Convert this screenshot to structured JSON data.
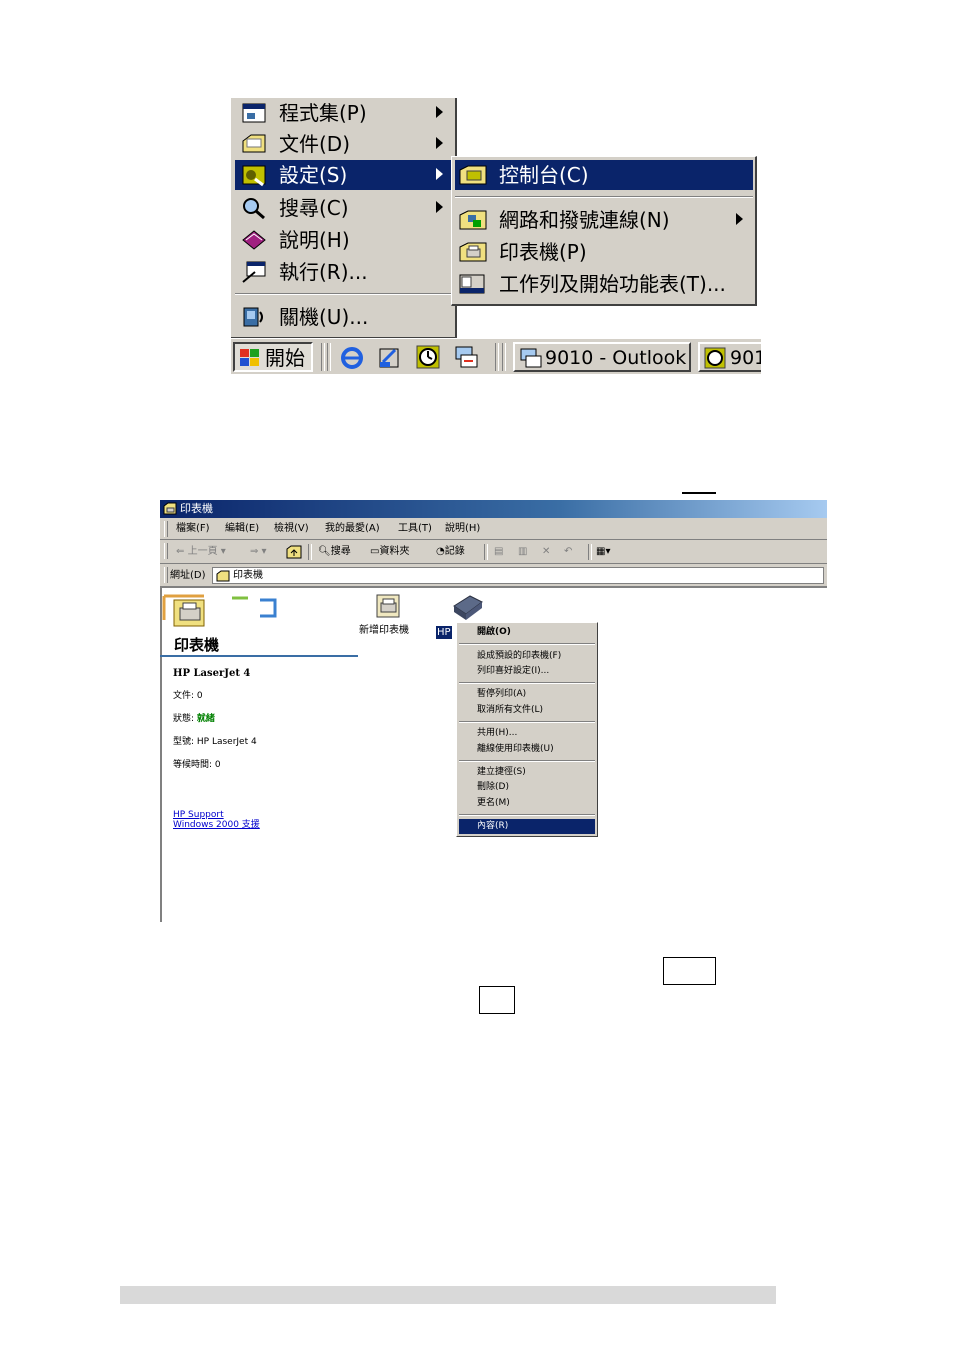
{
  "start_menu": {
    "items": [
      {
        "label": "程式集(P)",
        "icon": "programs-icon",
        "has_submenu": true
      },
      {
        "label": "文件(D)",
        "icon": "documents-icon",
        "has_submenu": true
      },
      {
        "label": "設定(S)",
        "icon": "settings-icon",
        "has_submenu": true,
        "selected": true
      },
      {
        "label": "搜尋(C)",
        "icon": "search-icon",
        "has_submenu": true
      },
      {
        "label": "說明(H)",
        "icon": "help-book-icon",
        "has_submenu": false
      },
      {
        "label": "執行(R)...",
        "icon": "run-icon",
        "has_submenu": false
      },
      {
        "label": "關機(U)...",
        "icon": "shutdown-icon",
        "has_submenu": false
      }
    ],
    "settings_submenu": [
      {
        "label": "控制台(C)",
        "icon": "control-panel-icon",
        "selected": true
      },
      {
        "label": "網路和撥號連線(N)",
        "icon": "network-icon",
        "has_submenu": true
      },
      {
        "label": "印表機(P)",
        "icon": "printers-folder-icon"
      },
      {
        "label": "工作列及開始功能表(T)...",
        "icon": "taskbar-icon"
      }
    ]
  },
  "taskbar": {
    "start_label": "開始",
    "tasks": [
      {
        "label": "9010 - Outlook ..."
      },
      {
        "label": "901"
      }
    ]
  },
  "printers_window": {
    "title": "印表機",
    "menubar": [
      "檔案(F)",
      "編輯(E)",
      "檢視(V)",
      "我的最愛(A)",
      "工具(T)",
      "說明(H)"
    ],
    "toolbar": {
      "back": "上一頁",
      "search": "搜尋",
      "folders": "資料夾",
      "history": "記錄"
    },
    "address": {
      "label": "網址(D)",
      "value": "印表機"
    },
    "left_pane": {
      "title": "印表機",
      "printer_name": "HP LaserJet 4",
      "documents_label": "文件: 0",
      "status_label": "狀態:",
      "status_value": "就緒",
      "model_label": "型號: HP LaserJet 4",
      "waiting_label": "等候時間: 0",
      "link1": "HP Support",
      "link2": "Windows 2000 支援"
    },
    "icons": {
      "add_printer": "新增印表機",
      "hp_printer": "HP"
    },
    "context_menu": [
      {
        "label": "開啟(O)",
        "bold": true
      },
      {
        "sep": true
      },
      {
        "label": "設成預設的印表機(F)"
      },
      {
        "label": "列印喜好設定(I)..."
      },
      {
        "sep": true
      },
      {
        "label": "暫停列印(A)"
      },
      {
        "label": "取消所有文件(L)"
      },
      {
        "sep": true
      },
      {
        "label": "共用(H)..."
      },
      {
        "label": "離線使用印表機(U)"
      },
      {
        "sep": true
      },
      {
        "label": "建立捷徑(S)"
      },
      {
        "label": "刪除(D)"
      },
      {
        "label": "更名(M)"
      },
      {
        "sep": true
      },
      {
        "label": "內容(R)",
        "selected": true
      }
    ]
  },
  "colors": {
    "selection": "#0a246a",
    "face": "#d4d0c8",
    "status_ready": "#008000",
    "link": "#0000cc"
  }
}
